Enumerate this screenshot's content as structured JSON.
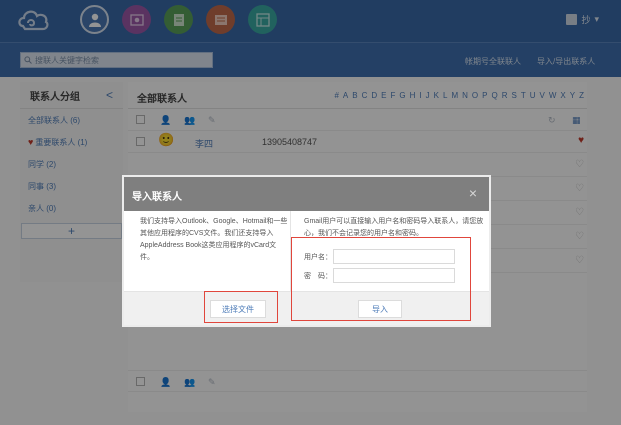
{
  "topbar": {
    "user_name": "抄",
    "user_arrow": "▾",
    "apps": [
      {
        "name": "contacts",
        "color": "#4a78b3",
        "active": true
      },
      {
        "name": "album",
        "color": "#9b58a8"
      },
      {
        "name": "notes",
        "color": "#5aa15a"
      },
      {
        "name": "mail",
        "color": "#c0694b"
      },
      {
        "name": "tasks",
        "color": "#3aa9a2"
      }
    ]
  },
  "subbar": {
    "search_placeholder": "搜联人关键字检索",
    "link_import_phone": "帐期号全联联人",
    "link_import_export": "导入/导出联系人"
  },
  "sidebar": {
    "title": "联系人分组",
    "collapse": "<",
    "groups": [
      {
        "label": "全部联系人 (6)"
      },
      {
        "label": "重要联系人 (1)"
      },
      {
        "label": "同学 (2)"
      },
      {
        "label": "同事 (3)"
      },
      {
        "label": "亲人 (0)"
      }
    ],
    "add_label": "+"
  },
  "main": {
    "title": "全部联系人",
    "alphabet": [
      "#",
      "A",
      "B",
      "C",
      "D",
      "E",
      "F",
      "G",
      "H",
      "I",
      "J",
      "K",
      "L",
      "M",
      "N",
      "O",
      "P",
      "Q",
      "R",
      "S",
      "T",
      "U",
      "V",
      "W",
      "X",
      "Y",
      "Z"
    ],
    "contact": {
      "name": "李四",
      "phone": "13905408747"
    }
  },
  "dialog": {
    "title": "导入联系人",
    "close": "×",
    "left_text": "我们支持导入Outlook、Google、Hotmail和一些其他应用程序的CVS文件。我们还支持导入AppleAddress Book这类应用程序的vCard文件。",
    "right_text": "Gmail用户可以直接输入用户名和密码导入联系人，请您放心，我们不会记录您的用户名和密码。",
    "username_label": "用户名：",
    "password_label": "密　码：",
    "choose_file_label": "选择文件",
    "import_label": "导入"
  },
  "colors": {
    "topbar": "#3a6aa8",
    "link": "#4e7cb8",
    "highlight": "#e0463c",
    "heart": "#c0392b"
  }
}
